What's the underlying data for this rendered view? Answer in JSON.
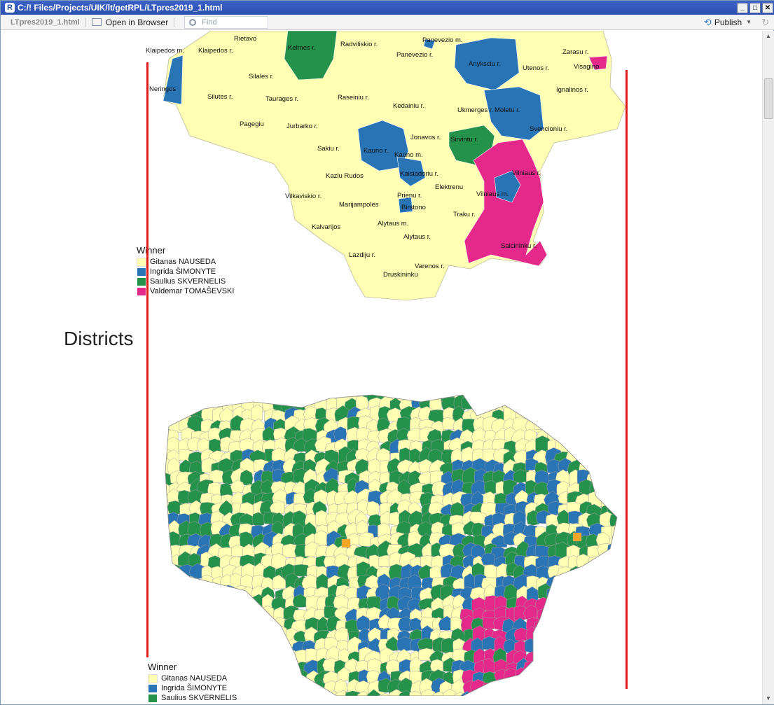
{
  "window": {
    "title": "C:/! Files/Projects/UIK/lt/getRPL/LTpres2019_1.html",
    "buttons": {
      "minimize": "_",
      "maximize": "□",
      "close": "✕"
    }
  },
  "toolbar": {
    "filename": "LTpres2019_1.html",
    "open_in_browser": "Open in Browser",
    "find_placeholder": "Find",
    "publish": "Publish"
  },
  "maps": {
    "municipalities": {
      "legend_title": "Winner",
      "labels": [
        "Rietavo",
        "Radviliskio r.",
        "Panevezio m.",
        "Klaipedos m.",
        "Klaipedos r.",
        "Kelmes r.",
        "Panevezio r.",
        "Zarasu r.",
        "Visagino",
        "Anyksciu r.",
        "Utenos r.",
        "Silales r.",
        "Neringos",
        "Ignalinos r.",
        "Silutes r.",
        "Taurages r.",
        "Raseiniu r.",
        "Kedainiu r.",
        "Ukmerges r.",
        "Moletu r.",
        "Pagegiu",
        "Jurbarko r.",
        "Svencioniu r.",
        "Jonavos r.",
        "Sirvintu r.",
        "Sakiu r.",
        "Kauno r.",
        "Kauno m.",
        "Kaisiadoriu r.",
        "Vilniaus r.",
        "Kazlu Rudos",
        "Elektrenu",
        "Vilniaus m.",
        "Vilkaviskio r.",
        "Prienu r.",
        "Marijampoles",
        "Birstono",
        "Traku r.",
        "Kalvarijos",
        "Alytaus m.",
        "Alytaus r.",
        "Salcininku r.",
        "Lazdiju r.",
        "Varenos r.",
        "Druskininku"
      ]
    },
    "districts": {
      "heading": "Districts",
      "legend_title": "Winner"
    },
    "legend": [
      {
        "name": "Gitanas NAUSEDA",
        "color": "#ffffb3"
      },
      {
        "name": "Ingrida ŠIMONYTE",
        "color": "#2874b5"
      },
      {
        "name": "Saulius SKVERNELIS",
        "color": "#24924a"
      },
      {
        "name": "Valdemar TOMAŠEVSKI",
        "color": "#e5298a"
      }
    ],
    "other_color": "#f5a623",
    "divider_color": "#e41a1c"
  }
}
